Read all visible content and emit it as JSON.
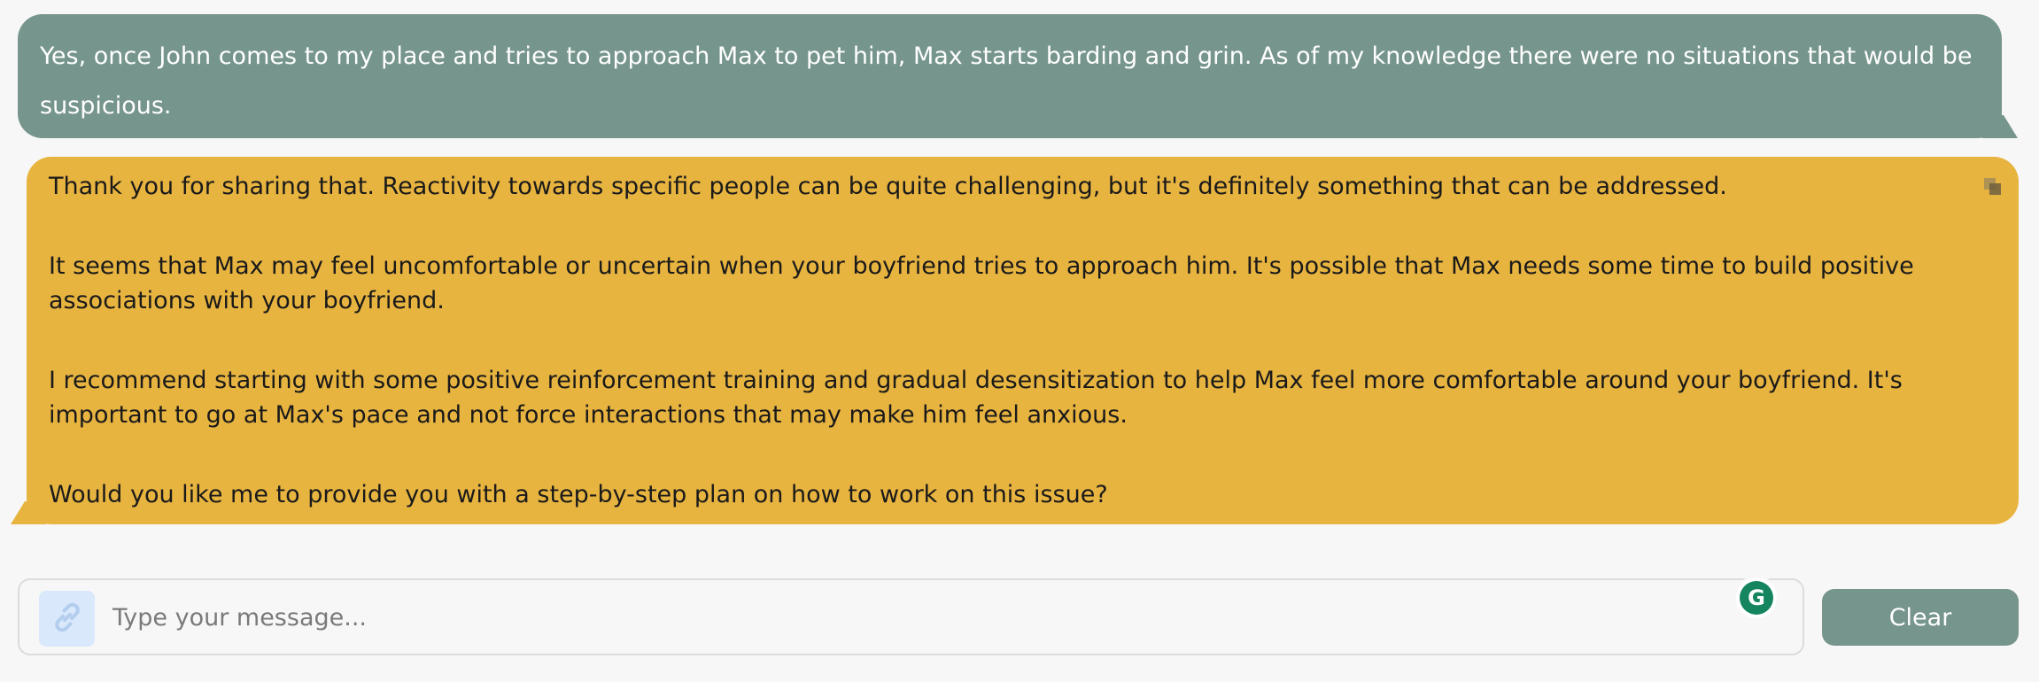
{
  "messages": [
    {
      "role": "user",
      "text": "Yes, once John comes to my place and tries to approach Max to pet him, Max starts barding and grin. As of my knowledge there were no situations that would be suspicious."
    },
    {
      "role": "assistant",
      "paragraphs": [
        "Thank you for sharing that. Reactivity towards specific people can be quite challenging, but it's definitely something that can be addressed.",
        "It seems that Max may feel uncomfortable or uncertain when your boyfriend tries to approach him. It's possible that Max needs some time to build positive associations with your boyfriend.",
        "I recommend starting with some positive reinforcement training and gradual desensitization to help Max feel more comfortable around your boyfriend. It's important to go at Max's pace and not force interactions that may make him feel anxious.",
        "Would you like me to provide you with a step-by-step plan on how to work on this issue?"
      ]
    }
  ],
  "composer": {
    "placeholder": "Type your message...",
    "attach_icon": "link-icon",
    "grammar_badge_letter": "G"
  },
  "clear_label": "Clear",
  "colors": {
    "user_bubble": "#76958c",
    "assistant_bubble": "#e8b440",
    "clear_button": "#76958c",
    "grammar_badge": "#15855f"
  }
}
